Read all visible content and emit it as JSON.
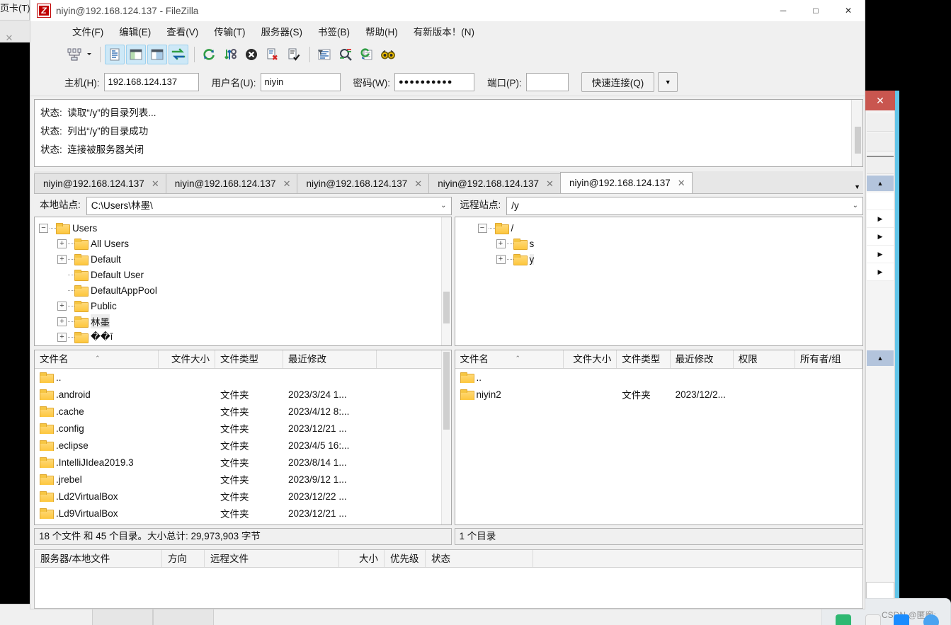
{
  "window": {
    "title": "niyin@192.168.124.137 - FileZilla",
    "logo_text": "Z",
    "minimize": "─",
    "maximize": "□",
    "close": "✕"
  },
  "menubar": [
    {
      "label": "文件(F)",
      "name": "menu-file"
    },
    {
      "label": "编辑(E)",
      "name": "menu-edit"
    },
    {
      "label": "查看(V)",
      "name": "menu-view"
    },
    {
      "label": "传输(T)",
      "name": "menu-transfer"
    },
    {
      "label": "服务器(S)",
      "name": "menu-server"
    },
    {
      "label": "书签(B)",
      "name": "menu-bookmarks"
    },
    {
      "label": "帮助(H)",
      "name": "menu-help"
    },
    {
      "label": "有新版本！(N)",
      "name": "menu-new-version"
    }
  ],
  "toolbar": {
    "icons": [
      {
        "name": "site-manager-icon",
        "glyph": "site-manager"
      },
      {
        "name": "dropdown-caret-icon",
        "glyph": "caret"
      },
      {
        "name": "toggle-message-log-icon",
        "glyph": "msglog",
        "active": true
      },
      {
        "name": "toggle-local-tree-icon",
        "glyph": "localtree",
        "active": true
      },
      {
        "name": "toggle-remote-tree-icon",
        "glyph": "remotetree",
        "active": true
      },
      {
        "name": "toggle-transfer-queue-icon",
        "glyph": "queue",
        "active": true
      },
      {
        "name": "refresh-icon",
        "glyph": "refresh"
      },
      {
        "name": "process-queue-icon",
        "glyph": "process"
      },
      {
        "name": "cancel-operation-icon",
        "glyph": "cancel"
      },
      {
        "name": "disconnect-icon",
        "glyph": "disconnect"
      },
      {
        "name": "reconnect-icon",
        "glyph": "reconnect"
      },
      {
        "name": "filter-icon",
        "glyph": "filter"
      },
      {
        "name": "directory-compare-icon",
        "glyph": "compare"
      },
      {
        "name": "synchronized-browsing-icon",
        "glyph": "sync"
      },
      {
        "name": "find-files-icon",
        "glyph": "find"
      }
    ]
  },
  "quickconnect": {
    "host_label": "主机(H):",
    "host_value": "192.168.124.137",
    "user_label": "用户名(U):",
    "user_value": "niyin",
    "password_label": "密码(W):",
    "password_value": "●●●●●●●●●●",
    "port_label": "端口(P):",
    "port_value": "",
    "connect_label": "快速连接(Q)",
    "dropdown_glyph": "▼"
  },
  "messagelog": {
    "lines": [
      "状态:  读取“/y”的目录列表...",
      "状态:  列出“/y”的目录成功",
      "状态:  连接被服务器关闭"
    ]
  },
  "tabs": {
    "items": [
      {
        "label": "niyin@192.168.124.137",
        "active": false
      },
      {
        "label": "niyin@192.168.124.137",
        "active": false
      },
      {
        "label": "niyin@192.168.124.137",
        "active": false
      },
      {
        "label": "niyin@192.168.124.137",
        "active": false
      },
      {
        "label": "niyin@192.168.124.137",
        "active": true
      }
    ],
    "close_glyph": "✕",
    "dropdown_glyph": "▼"
  },
  "local": {
    "path_label": "本地站点:",
    "path_value": "C:\\Users\\林墨\\",
    "path_caret": "⌄",
    "tree": [
      {
        "label": "Users",
        "indent": 0,
        "expander": "−",
        "selected": false
      },
      {
        "label": "All Users",
        "indent": 1,
        "expander": "+",
        "selected": false
      },
      {
        "label": "Default",
        "indent": 1,
        "expander": "+",
        "selected": false
      },
      {
        "label": "Default User",
        "indent": 1,
        "expander": "",
        "selected": false
      },
      {
        "label": "DefaultAppPool",
        "indent": 1,
        "expander": "",
        "selected": false
      },
      {
        "label": "Public",
        "indent": 1,
        "expander": "+",
        "selected": false
      },
      {
        "label": "林墨",
        "indent": 1,
        "expander": "+",
        "selected": true
      },
      {
        "label": "��ī",
        "indent": 1,
        "expander": "+",
        "selected": false
      }
    ],
    "columns": [
      {
        "label": "文件名",
        "width": 175,
        "align": "left"
      },
      {
        "label": "文件大小",
        "width": 80,
        "align": "right"
      },
      {
        "label": "文件类型",
        "width": 96,
        "align": "left"
      },
      {
        "label": "最近修改",
        "width": 132,
        "align": "left"
      }
    ],
    "sort_caret": "⌃",
    "rows": [
      {
        "name": "..",
        "size": "",
        "type": "",
        "modified": ""
      },
      {
        "name": ".android",
        "size": "",
        "type": "文件夹",
        "modified": "2023/3/24 1..."
      },
      {
        "name": ".cache",
        "size": "",
        "type": "文件夹",
        "modified": "2023/4/12 8:..."
      },
      {
        "name": ".config",
        "size": "",
        "type": "文件夹",
        "modified": "2023/12/21 ..."
      },
      {
        "name": ".eclipse",
        "size": "",
        "type": "文件夹",
        "modified": "2023/4/5 16:..."
      },
      {
        "name": ".IntelliJIdea2019.3",
        "size": "",
        "type": "文件夹",
        "modified": "2023/8/14 1..."
      },
      {
        "name": ".jrebel",
        "size": "",
        "type": "文件夹",
        "modified": "2023/9/12 1..."
      },
      {
        "name": ".Ld2VirtualBox",
        "size": "",
        "type": "文件夹",
        "modified": "2023/12/22 ..."
      },
      {
        "name": ".Ld9VirtualBox",
        "size": "",
        "type": "文件夹",
        "modified": "2023/12/21 ..."
      }
    ],
    "status": "18 个文件 和 45 个目录。大小总计: 29,973,903 字节"
  },
  "remote": {
    "path_label": "远程站点:",
    "path_value": "/y",
    "path_caret": "⌄",
    "tree": [
      {
        "label": "/",
        "indent": 0,
        "expander": "−",
        "selected": false
      },
      {
        "label": "s",
        "indent": 1,
        "expander": "+",
        "selected": false
      },
      {
        "label": "y",
        "indent": 1,
        "expander": "+",
        "selected": true
      }
    ],
    "columns": [
      {
        "label": "文件名",
        "width": 155,
        "align": "left"
      },
      {
        "label": "文件大小",
        "width": 76,
        "align": "right"
      },
      {
        "label": "文件类型",
        "width": 76,
        "align": "left"
      },
      {
        "label": "最近修改",
        "width": 90,
        "align": "left"
      },
      {
        "label": "权限",
        "width": 88,
        "align": "left"
      },
      {
        "label": "所有者/组",
        "width": 96,
        "align": "left"
      }
    ],
    "sort_caret": "⌃",
    "rows": [
      {
        "name": "..",
        "size": "",
        "type": "",
        "modified": "",
        "perms": "",
        "owner": ""
      },
      {
        "name": "niyin2",
        "size": "",
        "type": "文件夹",
        "modified": "2023/12/2...",
        "perms": "",
        "owner": ""
      }
    ],
    "status": "1 个目录"
  },
  "queue": {
    "columns": [
      {
        "label": "服务器/本地文件",
        "width": 180,
        "align": "left"
      },
      {
        "label": "方向",
        "width": 60,
        "align": "left"
      },
      {
        "label": "远程文件",
        "width": 190,
        "align": "left"
      },
      {
        "label": "大小",
        "width": 64,
        "align": "right"
      },
      {
        "label": "优先级",
        "width": 58,
        "align": "left"
      },
      {
        "label": "状态",
        "width": 152,
        "align": "left"
      }
    ]
  },
  "background": {
    "left_window_title": "页卡(T)",
    "left_tab_close": "✕",
    "side_close": "✕",
    "scroll_up_glyph": "▲",
    "scroll_down_glyph": "▲",
    "arrow_glyph": "▶",
    "watermark": "CSDN @匿廊:"
  },
  "colors": {
    "accent_blue": "#62c5e8",
    "folder_yellow": "#fdc73e",
    "close_red": "#c9564f",
    "selection_gray": "#ededed"
  }
}
